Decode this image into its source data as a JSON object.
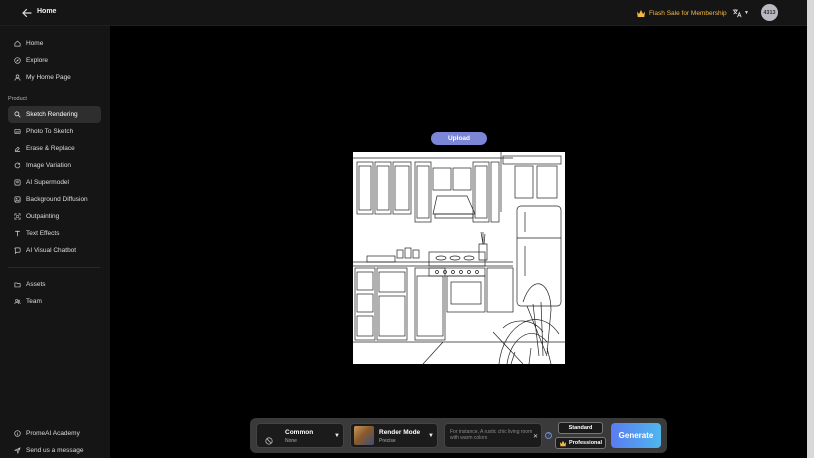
{
  "header": {
    "title": "Home",
    "flash_sale": "Flash Sale for Membership",
    "avatar_text": "4313"
  },
  "sidebar": {
    "top_items": [
      {
        "label": "Home",
        "icon": "home-icon"
      },
      {
        "label": "Explore",
        "icon": "compass-icon"
      },
      {
        "label": "My Home Page",
        "icon": "user-icon"
      }
    ],
    "section_label": "Product",
    "product_items": [
      {
        "label": "Sketch Rendering",
        "icon": "sketch-icon",
        "active": true
      },
      {
        "label": "Photo To Sketch",
        "icon": "photo-icon"
      },
      {
        "label": "Erase & Replace",
        "icon": "eraser-icon"
      },
      {
        "label": "Image Variation",
        "icon": "refresh-icon"
      },
      {
        "label": "AI Supermodel",
        "icon": "model-icon"
      },
      {
        "label": "Background Diffusion",
        "icon": "image-icon"
      },
      {
        "label": "Outpainting",
        "icon": "expand-icon"
      },
      {
        "label": "Text Effects",
        "icon": "text-icon"
      },
      {
        "label": "AI Visual Chatbot",
        "icon": "chat-icon"
      }
    ],
    "bottom_items": [
      {
        "label": "Assets",
        "icon": "folder-icon"
      },
      {
        "label": "Team",
        "icon": "team-icon"
      }
    ],
    "footer_items": [
      {
        "label": "PromeAI Academy",
        "icon": "info-icon"
      },
      {
        "label": "Send us a message",
        "icon": "send-icon"
      }
    ]
  },
  "canvas": {
    "upload_label": "Upload"
  },
  "toolbar": {
    "style": {
      "title": "Common",
      "sub": "None"
    },
    "render": {
      "title": "Render Mode",
      "sub": "Precise"
    },
    "prompt_placeholder": "For instance, A rustic chic living room with warm colors",
    "standard_label": "Standard",
    "professional_label": "Professional",
    "generate_label": "Generate"
  },
  "colors": {
    "accent": "#7b86d6",
    "flash": "#f5b942",
    "generate_start": "#5a7cf0",
    "generate_end": "#4fb7ee"
  }
}
